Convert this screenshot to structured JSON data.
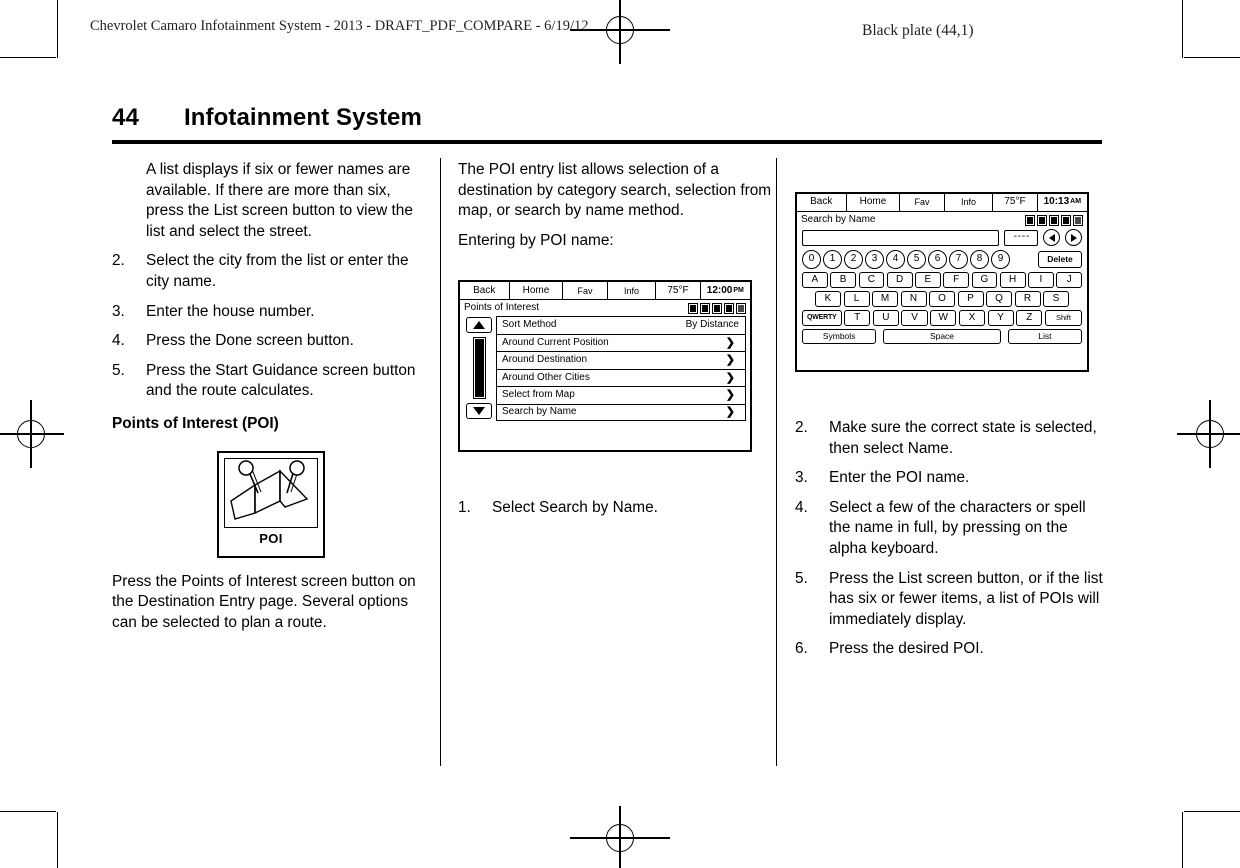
{
  "header": {
    "left": "Chevrolet Camaro Infotainment System - 2013 - DRAFT_PDF_COMPARE - 6/19/12",
    "right": "Black plate (44,1)"
  },
  "page": {
    "number": "44",
    "title": "Infotainment System"
  },
  "column1": {
    "intro": "A list displays if six or fewer names are available. If there are more than six, press the List screen button to view the list and select the street.",
    "steps": [
      {
        "n": "2.",
        "text": "Select the city from the list or enter the city name."
      },
      {
        "n": "3.",
        "text": "Enter the house number."
      },
      {
        "n": "4.",
        "text": "Press the Done screen button."
      },
      {
        "n": "5.",
        "text": "Press the Start Guidance screen button and the route calculates."
      }
    ],
    "subhead": "Points of Interest (POI)",
    "figure_label": "POI",
    "closing": "Press the Points of Interest screen button on the Destination Entry page. Several options can be selected to plan a route."
  },
  "column2": {
    "intro": "The POI entry list allows selection of a destination by category search, selection from map, or search by name method.",
    "lead": "Entering by POI name:",
    "poi_screen": {
      "topbar": {
        "back": "Back",
        "home": "Home",
        "fav": "Fav",
        "info": "Info",
        "temp": "75°F",
        "time": "12:00",
        "ampm": "PM"
      },
      "title": "Points of Interest",
      "rows": [
        {
          "label": "Sort Method",
          "value": "By Distance",
          "chevron": ""
        },
        {
          "label": "Around Current Position",
          "value": "",
          "chevron": "❯"
        },
        {
          "label": "Around Destination",
          "value": "",
          "chevron": "❯"
        },
        {
          "label": "Around Other Cities",
          "value": "",
          "chevron": "❯"
        },
        {
          "label": "Select from Map",
          "value": "",
          "chevron": "❯"
        },
        {
          "label": "Search by Name",
          "value": "",
          "chevron": "❯"
        }
      ]
    },
    "steps": [
      {
        "n": "1.",
        "text": "Select Search by Name."
      }
    ]
  },
  "column3": {
    "kbd_screen": {
      "topbar": {
        "back": "Back",
        "home": "Home",
        "fav": "Fav",
        "info": "Info",
        "temp": "75°F",
        "time": "10:13",
        "ampm": "AM"
      },
      "title": "Search by Name",
      "entry_value": "",
      "dash_label": "- - - -",
      "numbers": [
        "0",
        "1",
        "2",
        "3",
        "4",
        "5",
        "6",
        "7",
        "8",
        "9"
      ],
      "delete_label": "Delete",
      "row1": [
        "A",
        "B",
        "C",
        "D",
        "E",
        "F",
        "G",
        "H",
        "I",
        "J"
      ],
      "row2": [
        "K",
        "L",
        "M",
        "N",
        "O",
        "P",
        "Q",
        "R",
        "S"
      ],
      "row3": [
        "QWERTY",
        "T",
        "U",
        "V",
        "W",
        "X",
        "Y",
        "Z",
        "Shift"
      ],
      "symbols_label": "Symbols",
      "space_label": "Space",
      "list_label": "List"
    },
    "steps": [
      {
        "n": "2.",
        "text": "Make sure the correct state is selected, then select Name."
      },
      {
        "n": "3.",
        "text": "Enter the POI name."
      },
      {
        "n": "4.",
        "text": "Select a few of the characters or spell the name in full, by pressing on the alpha keyboard."
      },
      {
        "n": "5.",
        "text": "Press the List screen button, or if the list has six or fewer items, a list of POIs will immediately display."
      },
      {
        "n": "6.",
        "text": "Press the desired POI."
      }
    ]
  }
}
